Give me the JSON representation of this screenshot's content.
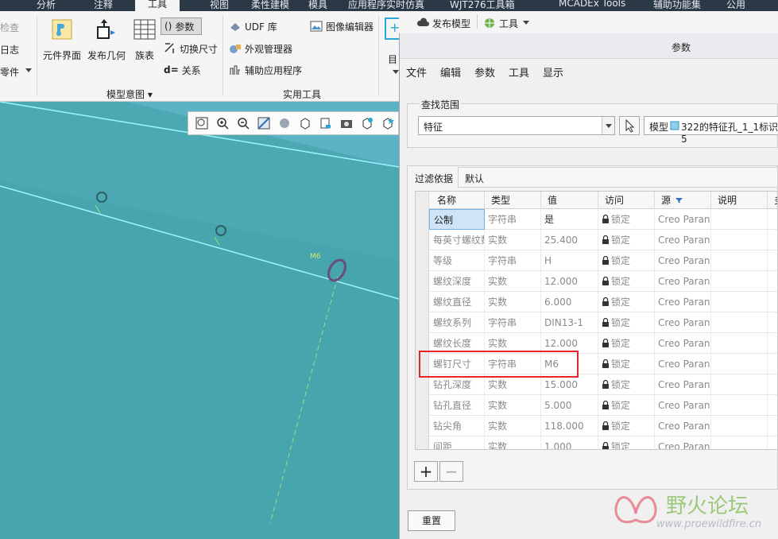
{
  "menubar": {
    "tabs": [
      "分析",
      "注释",
      "工具",
      "视图",
      "柔性建模",
      "模具",
      "应用程序实时仿真",
      "WJT276工具箱",
      "MCADEx Tools",
      "辅助功能集",
      "公用"
    ],
    "active_tab": "工具"
  },
  "ribbon": {
    "left_partial": [
      "检查",
      "日志",
      "零件"
    ],
    "big_buttons": [
      "元件界面",
      "发布几何",
      "族表"
    ],
    "model_intent_small": [
      "参数",
      "切换尺寸",
      "关系"
    ],
    "utilities_small": [
      "UDF 库",
      "外观管理器",
      "辅助应用程序",
      "图像编辑器"
    ],
    "group_model_intent": "模型意图",
    "group_utilities": "实用工具",
    "right_partial": "目",
    "publish_model": "发布模型",
    "tools_button": "工具"
  },
  "dialog": {
    "title": "参数",
    "menu": [
      "文件",
      "编辑",
      "参数",
      "工具",
      "显示"
    ],
    "lookin_legend": "查找范围",
    "lookin_value": "特征",
    "model_label": "模型",
    "model_value": "322的特征孔_1_1标识5",
    "filter_label": "过滤依据",
    "filter_value": "默认",
    "columns": [
      "名称",
      "类型",
      "值",
      "访问",
      "源",
      "说明",
      "多"
    ],
    "rows": [
      {
        "name": "公制",
        "type": "字符串",
        "value": "是",
        "access": "锁定",
        "source": "Creo Paran"
      },
      {
        "name": "每英寸螺纹数",
        "type": "实数",
        "value": "25.400",
        "access": "锁定",
        "source": "Creo Paran"
      },
      {
        "name": "等级",
        "type": "字符串",
        "value": "H",
        "access": "锁定",
        "source": "Creo Paran"
      },
      {
        "name": "螺纹深度",
        "type": "实数",
        "value": "12.000",
        "access": "锁定",
        "source": "Creo Paran"
      },
      {
        "name": "螺纹直径",
        "type": "实数",
        "value": "6.000",
        "access": "锁定",
        "source": "Creo Paran"
      },
      {
        "name": "螺纹系列",
        "type": "字符串",
        "value": "DIN13-1",
        "access": "锁定",
        "source": "Creo Paran"
      },
      {
        "name": "螺纹长度",
        "type": "实数",
        "value": "12.000",
        "access": "锁定",
        "source": "Creo Paran"
      },
      {
        "name": "螺钉尺寸",
        "type": "字符串",
        "value": "M6",
        "access": "锁定",
        "source": "Creo Paran"
      },
      {
        "name": "钻孔深度",
        "type": "实数",
        "value": "15.000",
        "access": "锁定",
        "source": "Creo Paran"
      },
      {
        "name": "钻孔直径",
        "type": "实数",
        "value": "5.000",
        "access": "锁定",
        "source": "Creo Paran"
      },
      {
        "name": "钻尖角",
        "type": "实数",
        "value": "118.000",
        "access": "锁定",
        "source": "Creo Paran"
      },
      {
        "name": "间距",
        "type": "实数",
        "value": "1.000",
        "access": "锁定",
        "source": "Creo Paran"
      }
    ],
    "add_label": "+",
    "remove_label": "−",
    "reset_label": "重置"
  },
  "viewport": {
    "annotation": "M6"
  },
  "watermark": {
    "title": "野火论坛",
    "url": "www.proewildfire.cn"
  }
}
